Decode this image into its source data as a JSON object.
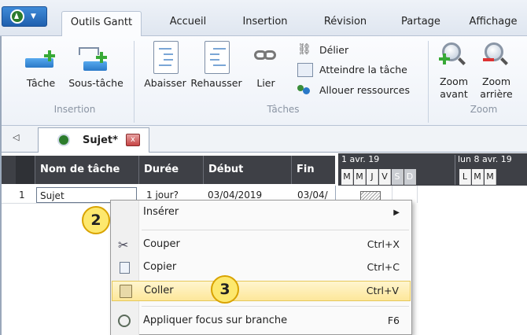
{
  "tabs": [
    {
      "label": "Outils Gantt",
      "active": true
    },
    {
      "label": "Accueil"
    },
    {
      "label": "Insertion"
    },
    {
      "label": "Révision"
    },
    {
      "label": "Partage"
    },
    {
      "label": "Affichage"
    }
  ],
  "ribbon": {
    "groups": {
      "insertion": "Insertion",
      "taches": "Tâches",
      "zoom": "Zoom"
    },
    "tache": "Tâche",
    "sous_tache": "Sous-tâche",
    "abaisser": "Abaisser",
    "rehausser": "Rehausser",
    "lier": "Lier",
    "delier": "Délier",
    "atteindre": "Atteindre la tâche",
    "allouer": "Allouer ressources",
    "zoom_avant_1": "Zoom",
    "zoom_avant_2": "avant",
    "zoom_arriere_1": "Zoom",
    "zoom_arriere_2": "arrière"
  },
  "doc_tab": {
    "label": "Sujet*",
    "close": "x"
  },
  "grid": {
    "headers": [
      "Nom de tâche",
      "Durée",
      "Début",
      "Fin"
    ],
    "row": {
      "num": "1",
      "name": "Sujet",
      "duree": "1 jour?",
      "debut": "03/04/2019",
      "fin": "03/04/"
    }
  },
  "gantt": {
    "week1": "1 avr. 19",
    "week2": "lun 8 avr. 19",
    "days": [
      "M",
      "M",
      "J",
      "V",
      "S",
      "D",
      "L",
      "M",
      "M"
    ]
  },
  "context_menu": {
    "inserer": "Insérer",
    "couper": "Couper",
    "couper_sc": "Ctrl+X",
    "copier": "Copier",
    "copier_sc": "Ctrl+C",
    "coller": "Coller",
    "coller_sc": "Ctrl+V",
    "focus": "Appliquer focus sur branche",
    "focus_sc": "F6"
  },
  "callouts": {
    "c2": "2",
    "c3": "3"
  },
  "colors": {
    "accent": "#2a79c8",
    "highlight": "#fde79a",
    "header": "#3e4046"
  }
}
